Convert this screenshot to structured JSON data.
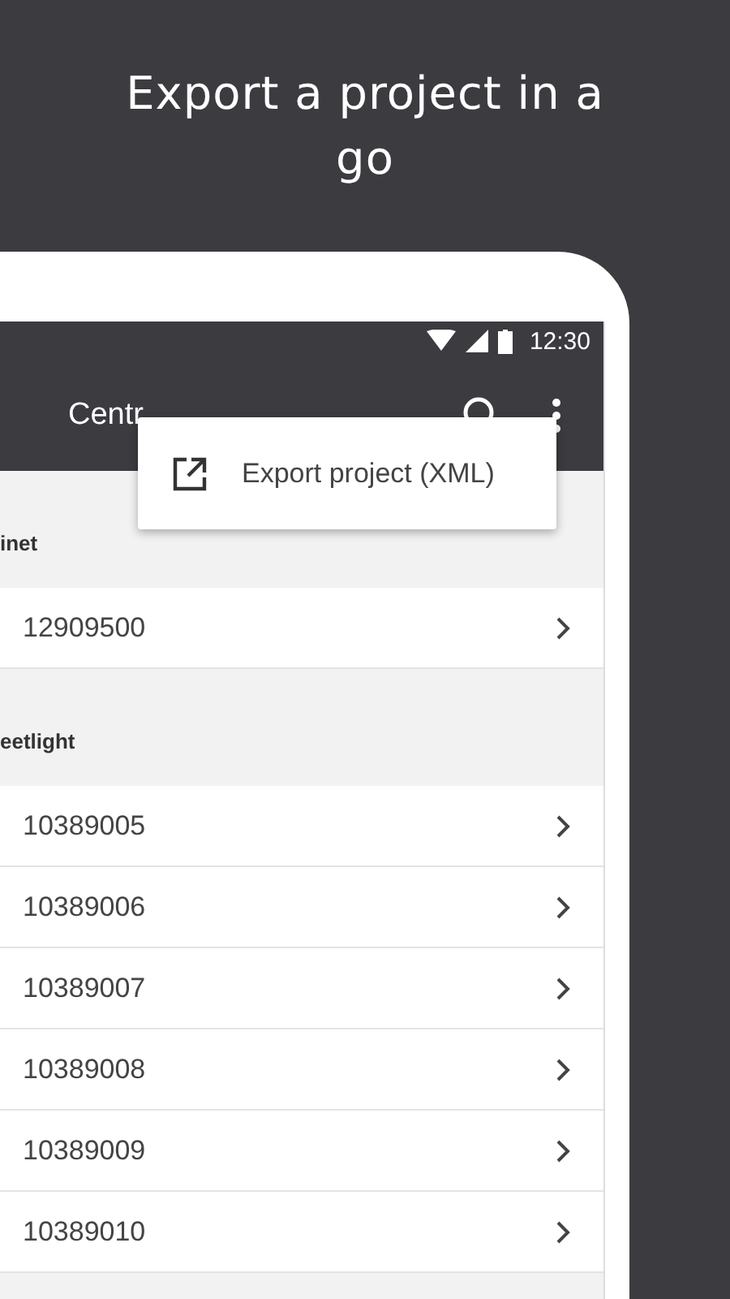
{
  "headline": "Export a project in a go",
  "status_bar": {
    "time": "12:30"
  },
  "toolbar": {
    "title": "Centr"
  },
  "menu": {
    "items": [
      {
        "label": "Export project (XML)"
      }
    ]
  },
  "sections": [
    {
      "title": "inet",
      "items": [
        {
          "label": "12909500"
        }
      ]
    },
    {
      "title": "eetlight",
      "items": [
        {
          "label": "10389005"
        },
        {
          "label": "10389006"
        },
        {
          "label": "10389007"
        },
        {
          "label": "10389008"
        },
        {
          "label": "10389009"
        },
        {
          "label": "10389010"
        }
      ]
    }
  ]
}
